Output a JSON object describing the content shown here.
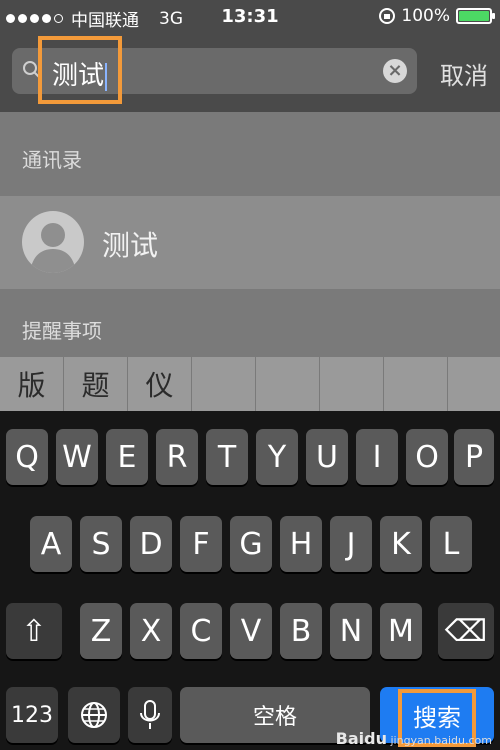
{
  "status_bar": {
    "carrier": "中国联通",
    "network": "3G",
    "time": "13:31",
    "battery": "100%",
    "battery_level": 1.0,
    "battery_color": "#4cd964"
  },
  "search": {
    "query": "测试",
    "cancel_label": "取消",
    "clear_icon": "ⓧ"
  },
  "results": {
    "section_contacts": "通讯录",
    "contact_name": "测试",
    "section_reminders": "提醒事项"
  },
  "candidates": [
    "版",
    "题",
    "仪",
    "",
    "",
    "",
    "",
    ""
  ],
  "keyboard": {
    "row1": [
      "Q",
      "W",
      "E",
      "R",
      "T",
      "Y",
      "U",
      "I",
      "O",
      "P"
    ],
    "row2": [
      "A",
      "S",
      "D",
      "F",
      "G",
      "H",
      "J",
      "K",
      "L"
    ],
    "row3": [
      "Z",
      "X",
      "C",
      "V",
      "B",
      "N",
      "M"
    ],
    "shift_label": "⇧",
    "delete_label": "⌫",
    "numbers_label": "123",
    "space_label": "空格",
    "search_label": "搜索"
  },
  "watermark": {
    "brand": "Baidu",
    "sub": "jingyan.baidu.com"
  },
  "colors": {
    "accent": "#1e7cf2",
    "highlight": "#f39a3a"
  }
}
